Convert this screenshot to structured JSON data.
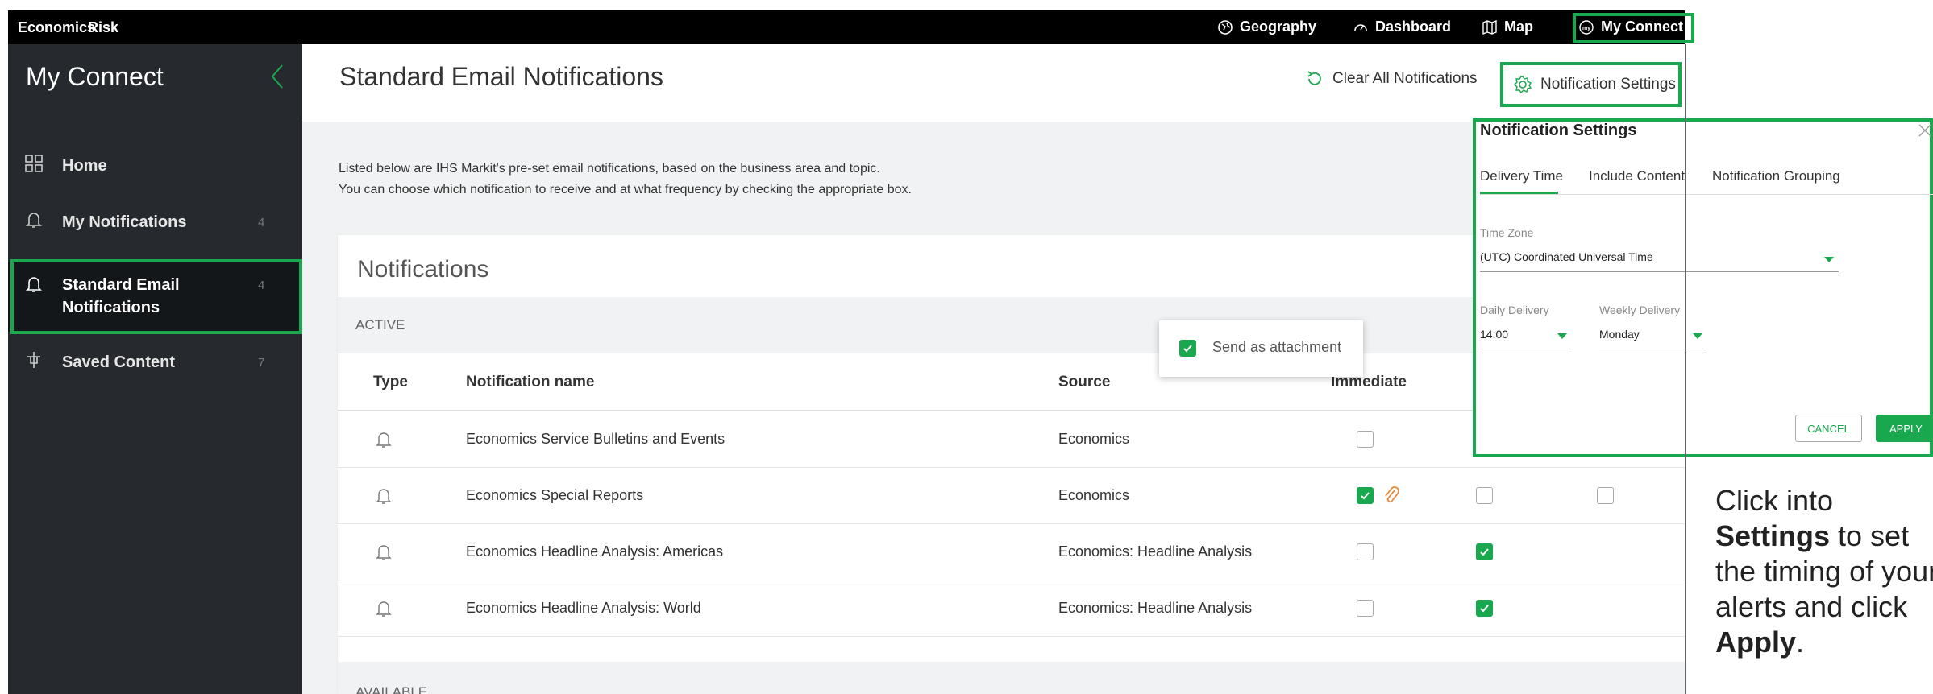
{
  "topbar": {
    "left_items": [
      "Economics",
      "Risk"
    ],
    "right_items": [
      {
        "label": "Geography",
        "icon": "globe-icon"
      },
      {
        "label": "Dashboard",
        "icon": "dashboard-icon"
      },
      {
        "label": "Map",
        "icon": "map-icon"
      },
      {
        "label": "My Connect",
        "icon": "my-connect-icon"
      }
    ]
  },
  "sidebar": {
    "title": "My Connect",
    "items": [
      {
        "label": "Home",
        "count": "",
        "icon": "home-icon"
      },
      {
        "label": "My Notifications",
        "count": "4",
        "icon": "bell-icon"
      },
      {
        "label": "Standard Email",
        "label2": "Notifications",
        "count": "4",
        "icon": "bell-icon",
        "active": true
      },
      {
        "label": "Saved Content",
        "count": "7",
        "icon": "bookmark-icon"
      }
    ]
  },
  "main": {
    "title": "Standard Email Notifications",
    "clear_all": "Clear All Notifications",
    "settings_button": "Notification Settings",
    "description_line1": "Listed below are IHS Markit's pre-set email notifications, based on the business area and topic.",
    "description_line2": "You can choose which notification to receive and at what frequency by checking the appropriate box.",
    "card_title": "Notifications",
    "active_label": "ACTIVE",
    "available_label": "AVAILABLE",
    "columns": [
      "Type",
      "Notification name",
      "Source",
      "Immediate"
    ],
    "rows": [
      {
        "name": "Economics Service Bulletins and Events",
        "source": "Economics",
        "immediate": false,
        "daily": null,
        "weekly": null
      },
      {
        "name": "Economics Special Reports",
        "source": "Economics",
        "immediate": true,
        "daily": false,
        "weekly": false
      },
      {
        "name": "Economics Headline Analysis: Americas",
        "source": "Economics: Headline Analysis",
        "immediate": false,
        "daily": true,
        "weekly": null
      },
      {
        "name": "Economics Headline Analysis: World",
        "source": "Economics: Headline Analysis",
        "immediate": false,
        "daily": true,
        "weekly": null
      }
    ],
    "tooltip": "Send as attachment"
  },
  "popover": {
    "title": "Notification Settings",
    "tabs": [
      "Delivery Time",
      "Include Content",
      "Notification Grouping"
    ],
    "timezone_label": "Time Zone",
    "timezone_value": "(UTC) Coordinated Universal Time",
    "daily_label": "Daily Delivery",
    "daily_value": "14:00",
    "weekly_label": "Weekly Delivery",
    "weekly_value": "Monday",
    "cancel": "CANCEL",
    "apply": "APPLY"
  },
  "callout": {
    "line1": "Click into",
    "line2_bold": "Settings",
    "line2_rest": " to set",
    "line3": "the timing of your",
    "line4": "alerts and click",
    "line5_bold": "Apply",
    "line5_rest": "."
  },
  "colors": {
    "accent": "#1aa84e",
    "sidebar": "#262a2f",
    "topbar": "#000000"
  }
}
